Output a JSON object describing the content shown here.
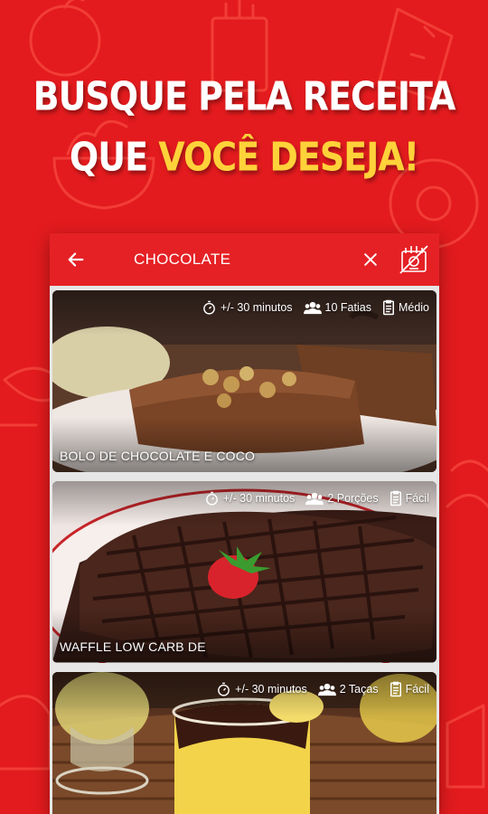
{
  "promo": {
    "line1": "BUSQUE PELA RECEITA",
    "line2_prefix": "QUE ",
    "line2_highlight": "VOCÊ DESEJA!"
  },
  "search": {
    "query": "CHOCOLATE",
    "back_icon": "arrow-back-icon",
    "clear_icon": "close-icon",
    "filter_icon": "filter-icon"
  },
  "recipes": [
    {
      "title": "BOLO DE CHOCOLATE E COCO",
      "time": "+/- 30 minutos",
      "yield": "10 Fatias",
      "difficulty": "Médio"
    },
    {
      "title": "WAFFLE LOW CARB DE",
      "time": "+/- 30 minutos",
      "yield": "2 Porções",
      "difficulty": "Fácil"
    },
    {
      "title": "",
      "time": "+/- 30 minutos",
      "yield": "2 Taças",
      "difficulty": "Fácil"
    }
  ],
  "colors": {
    "background": "#e31b1e",
    "appbar": "#e52125",
    "highlight": "#ffd23a"
  }
}
